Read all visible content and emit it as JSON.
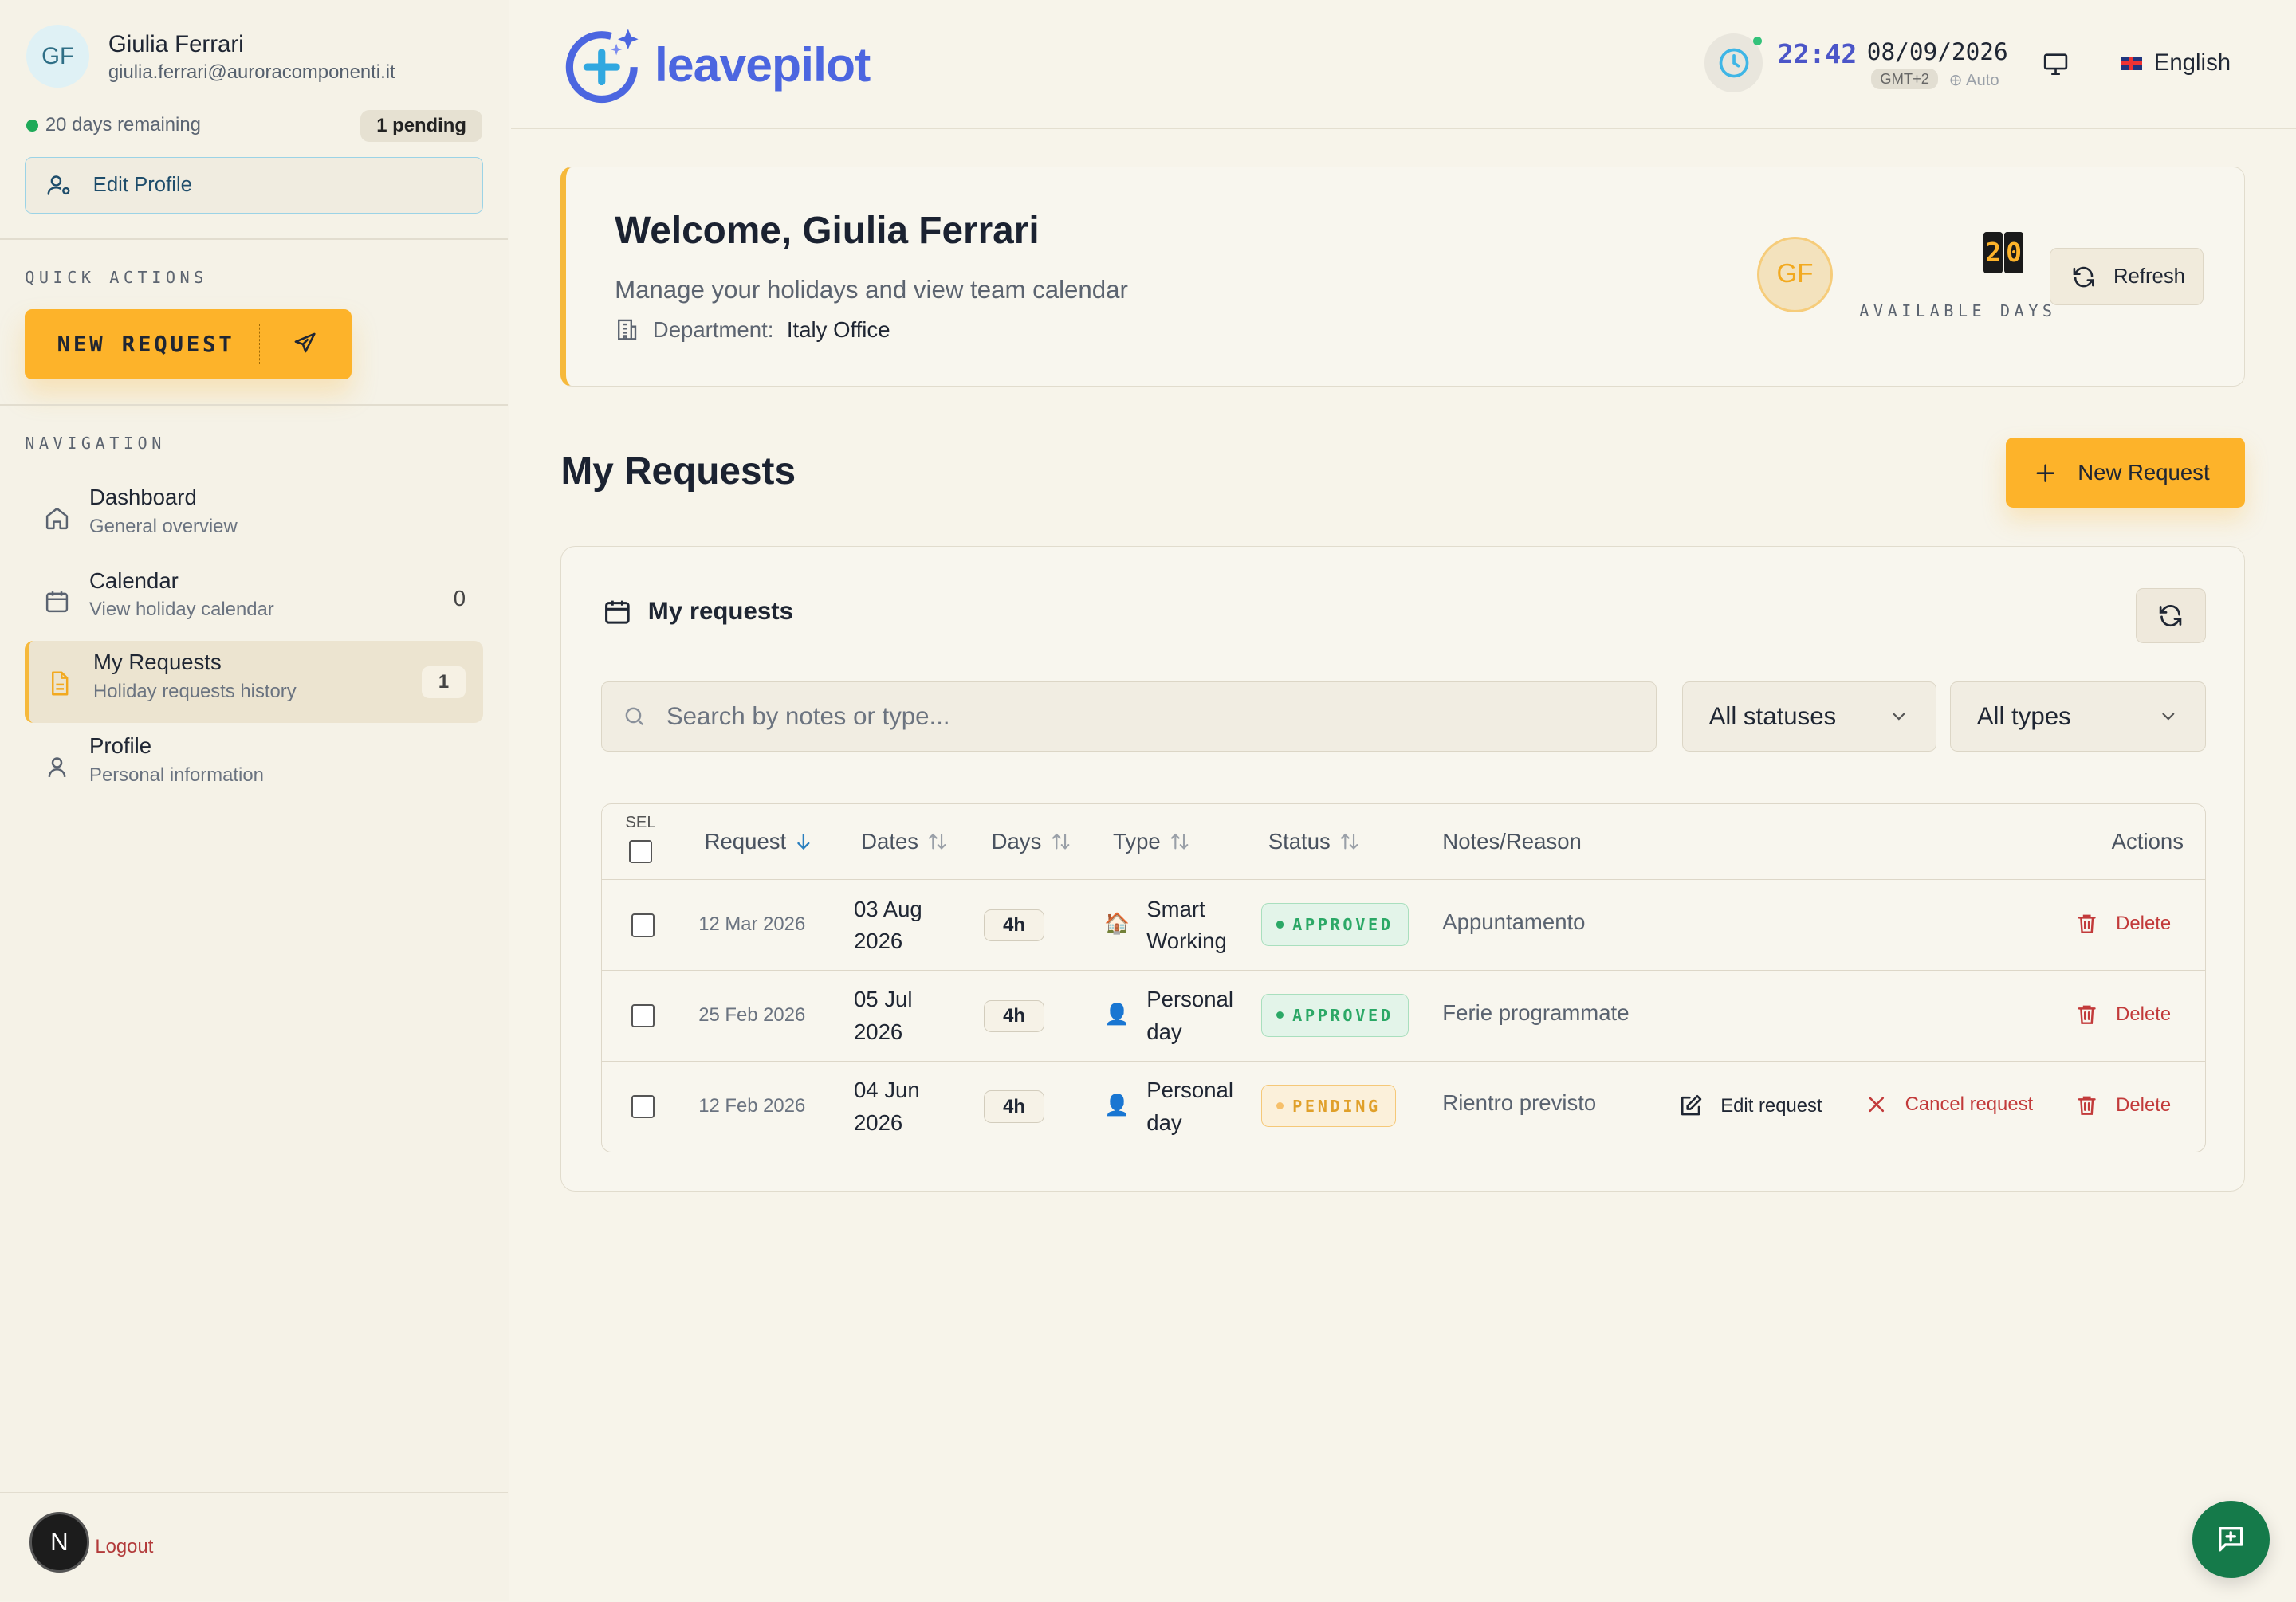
{
  "user": {
    "initials": "GF",
    "name": "Giulia Ferrari",
    "email": "giulia.ferrari@auroracomponenti.it",
    "days_remaining": "20 days remaining",
    "pending": "1 pending",
    "edit_profile": "Edit Profile"
  },
  "sidebar": {
    "quick_actions_label": "QUICK ACTIONS",
    "new_request_label": "NEW REQUEST",
    "navigation_label": "NAVIGATION",
    "items": [
      {
        "title": "Dashboard",
        "subtitle": "General overview",
        "badge": ""
      },
      {
        "title": "Calendar",
        "subtitle": "View holiday calendar",
        "badge": "0"
      },
      {
        "title": "My Requests",
        "subtitle": "Holiday requests history",
        "badge": "1"
      },
      {
        "title": "Profile",
        "subtitle": "Personal information",
        "badge": ""
      }
    ],
    "logout_initial": "N",
    "logout_label": "Logout"
  },
  "topbar": {
    "logo_text": "leavepilot",
    "time": "22:42",
    "date": "08/09/2026",
    "timezone": "GMT+2",
    "tz_mode": "⊕ Auto",
    "language": "English"
  },
  "welcome": {
    "title": "Welcome, Giulia Ferrari",
    "subtitle": "Manage your holidays and view team calendar",
    "department_label": "Department:",
    "department_value": "Italy Office",
    "initials": "GF",
    "available_digits": [
      "2",
      "0"
    ],
    "available_label": "AVAILABLE DAYS",
    "refresh_label": "Refresh"
  },
  "my_requests": {
    "title": "My Requests",
    "new_request_label": "New Request",
    "panel_title": "My requests",
    "search_placeholder": "Search by notes or type...",
    "status_filter": "All statuses",
    "type_filter": "All types",
    "columns": {
      "sel": "SEL",
      "request": "Request",
      "dates": "Dates",
      "days": "Days",
      "type": "Type",
      "status": "Status",
      "notes": "Notes/Reason",
      "actions": "Actions"
    },
    "rows": [
      {
        "request": "12 Mar 2026",
        "dates": "03 Aug 2026",
        "days": "4h",
        "type_icon": "🏠",
        "type": "Smart Working",
        "status": "APPROVED",
        "notes": "Appuntamento",
        "delete": "Delete"
      },
      {
        "request": "25 Feb 2026",
        "dates": "05 Jul 2026",
        "days": "4h",
        "type_icon": "👤",
        "type": "Personal day",
        "status": "APPROVED",
        "notes": "Ferie programmate",
        "delete": "Delete"
      },
      {
        "request": "12 Feb 2026",
        "dates": "04 Jun 2026",
        "days": "4h",
        "type_icon": "👤",
        "type": "Personal day",
        "status": "PENDING",
        "notes": "Rientro previsto",
        "edit": "Edit request",
        "cancel": "Cancel request",
        "delete": "Delete"
      }
    ]
  },
  "colors": {
    "accent": "#fdb32a",
    "brand": "#4c66e0",
    "approved": "#2ba866",
    "pending": "#e0a02a",
    "danger": "#c23a3a"
  }
}
